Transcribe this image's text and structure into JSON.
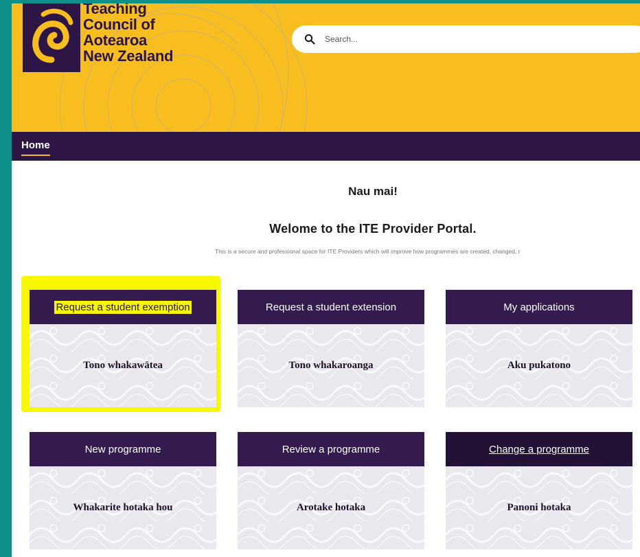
{
  "org": {
    "name_lines": [
      "Teaching",
      "Council of",
      "Aotearoa",
      "New Zealand"
    ]
  },
  "search": {
    "placeholder": "Search..."
  },
  "nav": {
    "home_label": "Home"
  },
  "welcome": {
    "greeting": "Nau mai!",
    "title": "Welome to the ITE Provider Portal.",
    "intro": "This is a secure and professional space for ITE Providers which will improve how programmes are created, changed, r"
  },
  "tiles": [
    {
      "title": "Request a student exemption",
      "subtitle": "Tono whakawātea"
    },
    {
      "title": "Request a student extension",
      "subtitle": "Tono whakaroanga"
    },
    {
      "title": "My applications",
      "subtitle": "Aku pukatono"
    },
    {
      "title": "New programme",
      "subtitle": "Whakarite hotaka hou"
    },
    {
      "title": "Review a programme",
      "subtitle": "Arotake hotaka"
    },
    {
      "title": "Change a programme",
      "subtitle": "Panoni hotaka"
    }
  ],
  "colors": {
    "brand_yellow": "#f8bd1f",
    "brand_purple": "#2d1646",
    "frame_teal": "#0e8f8a",
    "highlight": "#f7f700"
  }
}
